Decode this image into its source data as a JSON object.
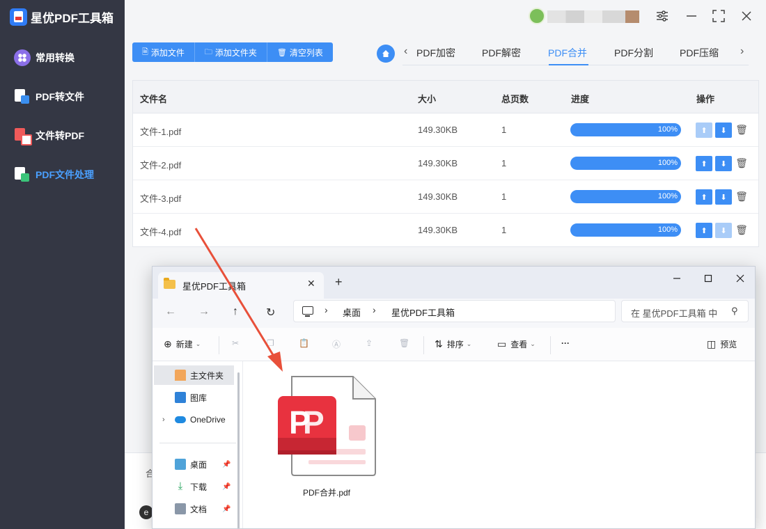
{
  "app": {
    "title": "星优PDF工具箱",
    "nav": [
      {
        "label": "常用转换",
        "icon": "apps-icon"
      },
      {
        "label": "PDF转文件",
        "icon": "pdf-to-file-icon"
      },
      {
        "label": "文件转PDF",
        "icon": "file-to-pdf-icon"
      },
      {
        "label": "PDF文件处理",
        "icon": "pdf-process-icon",
        "active": true
      }
    ]
  },
  "toolbar": {
    "add_file": "添加文件",
    "add_folder": "添加文件夹",
    "clear_list": "清空列表"
  },
  "tabs": [
    "PDF加密",
    "PDF解密",
    "PDF合并",
    "PDF分割",
    "PDF压缩"
  ],
  "active_tab": "PDF合并",
  "table": {
    "headers": {
      "name": "文件名",
      "size": "大小",
      "pages": "总页数",
      "progress": "进度",
      "actions": "操作"
    },
    "rows": [
      {
        "name": "文件-1.pdf",
        "size": "149.30KB",
        "pages": "1",
        "progress": "100%"
      },
      {
        "name": "文件-2.pdf",
        "size": "149.30KB",
        "pages": "1",
        "progress": "100%"
      },
      {
        "name": "文件-3.pdf",
        "size": "149.30KB",
        "pages": "1",
        "progress": "100%"
      },
      {
        "name": "文件-4.pdf",
        "size": "149.30KB",
        "pages": "1",
        "progress": "100%"
      }
    ]
  },
  "lower": {
    "text": "合",
    "badge": "e"
  },
  "explorer": {
    "tab_title": "星优PDF工具箱",
    "breadcrumb": [
      "桌面",
      "星优PDF工具箱"
    ],
    "search_placeholder": "在 星优PDF工具箱 中",
    "commands": {
      "new": "新建",
      "sort": "排序",
      "view": "查看",
      "more": "···",
      "preview": "预览"
    },
    "sidebar": {
      "home": "主文件夹",
      "gallery": "图库",
      "onedrive": "OneDrive",
      "desktop": "桌面",
      "downloads": "下载",
      "documents": "文档"
    },
    "file_name": "PDF合并.pdf"
  },
  "colors": {
    "accent": "#3d8ef5",
    "sidebar_bg": "#343744",
    "arrow": "#e8503a",
    "pdf_red": "#e8323f"
  }
}
